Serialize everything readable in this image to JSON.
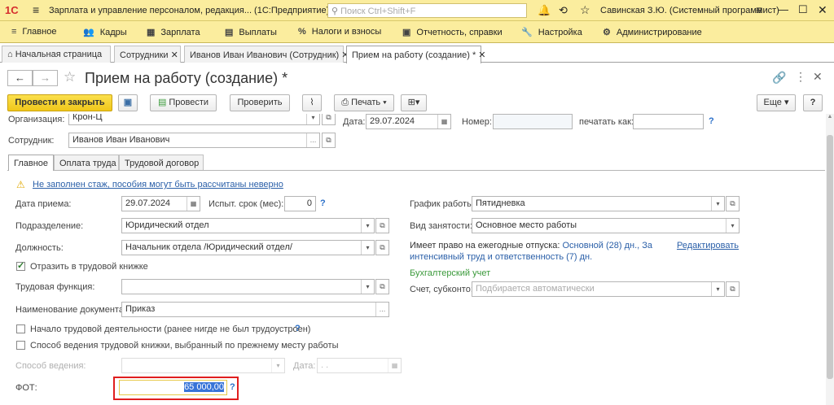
{
  "titlebar": {
    "logo": "1С",
    "app_title": "Зарплата и управление персоналом, редакция... (1С:Предприятие)",
    "search_placeholder": "Поиск Ctrl+Shift+F",
    "user": "Савинская З.Ю. (Системный программист)"
  },
  "menu": [
    {
      "label": "Главное",
      "icon": "≡"
    },
    {
      "label": "Кадры",
      "icon": "👥"
    },
    {
      "label": "Зарплата",
      "icon": "▦"
    },
    {
      "label": "Выплаты",
      "icon": "▤"
    },
    {
      "label": "Налоги и взносы",
      "icon": "%"
    },
    {
      "label": "Отчетность, справки",
      "icon": "▣"
    },
    {
      "label": "Настройка",
      "icon": "🔧"
    },
    {
      "label": "Администрирование",
      "icon": "⚙"
    }
  ],
  "tabs": [
    "Начальная страница",
    "Сотрудники",
    "Иванов Иван Иванович (Сотрудник)",
    "Прием на работу (создание) *"
  ],
  "form": {
    "title": "Прием на работу (создание) *"
  },
  "toolbar": {
    "post_close": "Провести и закрыть",
    "post": "Провести",
    "check": "Проверить",
    "print": "Печать",
    "more": "Еще",
    "help": "?"
  },
  "header": {
    "org_label": "Организация:",
    "org_value": "Крон-Ц",
    "date_label": "Дата:",
    "date_value": "29.07.2024",
    "number_label": "Номер:",
    "print_as_label": "печатать как:",
    "employee_label": "Сотрудник:",
    "employee_value": "Иванов Иван Иванович"
  },
  "inner_tabs": [
    "Главное",
    "Оплата труда",
    "Трудовой договор"
  ],
  "warning": "Не заполнен стаж, пособия могут быть рассчитаны неверно",
  "fields": {
    "hire_date_label": "Дата приема:",
    "hire_date": "29.07.2024",
    "probation_label": "Испыт. срок (мес):",
    "probation": "0",
    "department_label": "Подразделение:",
    "department": "Юридический отдел",
    "position_label": "Должность:",
    "position": "Начальник отдела /Юридический отдел/",
    "workbook_check": "Отразить в трудовой книжке",
    "labor_function_label": "Трудовая функция:",
    "doc_name_label": "Наименование документа:",
    "doc_name": "Приказ",
    "start_work_check": "Начало трудовой деятельности (ранее нигде не был трудоустроен)",
    "workbook_method_check": "Способ ведения трудовой книжки, выбранный по прежнему месту работы",
    "method_label": "Способ ведения:",
    "method_date_label": "Дата:",
    "method_date": ". .",
    "fot_label": "ФОТ:",
    "fot": "65 000,00",
    "schedule_label": "График работы:",
    "schedule": "Пятидневка",
    "employment_label": "Вид занятости:",
    "employment": "Основное место работы",
    "vacation_label": "Имеет право на ежегодные отпуска:",
    "vacation": "Основной (28) дн., За интенсивный труд и ответственность (7) дн.",
    "edit_link": "Редактировать",
    "accounting_header": "Бухгалтерский учет",
    "account_label": "Счет, субконто:",
    "account_placeholder": "Подбирается автоматически"
  }
}
